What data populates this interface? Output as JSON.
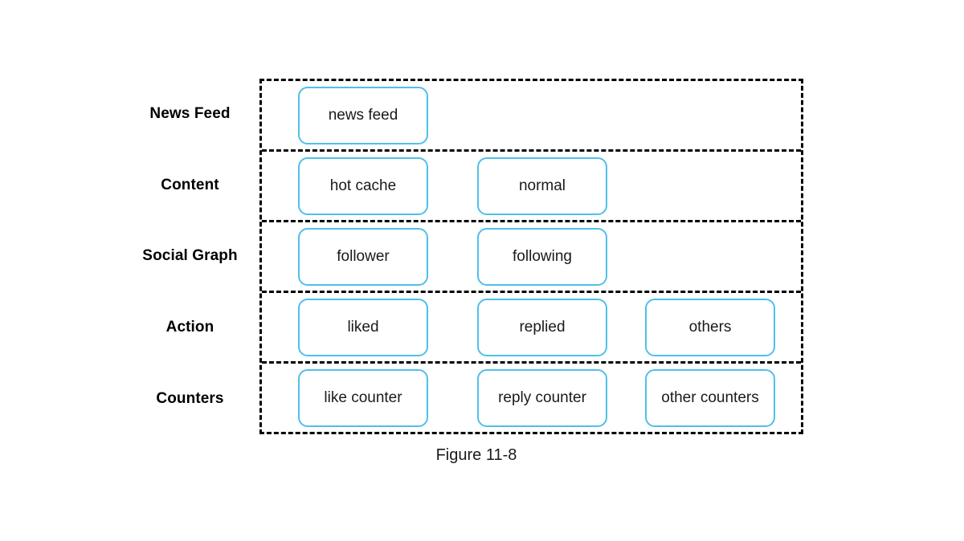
{
  "figure": {
    "caption": "Figure 11-8",
    "accent_color": "#4FC0E8",
    "boundary_color": "#000000",
    "background_color": "#ffffff"
  },
  "tiers": [
    {
      "label": "News Feed",
      "nodes": [
        {
          "label": "news feed"
        }
      ]
    },
    {
      "label": "Content",
      "nodes": [
        {
          "label": "hot cache"
        },
        {
          "label": "normal"
        }
      ]
    },
    {
      "label": "Social Graph",
      "nodes": [
        {
          "label": "follower"
        },
        {
          "label": "following"
        }
      ]
    },
    {
      "label": "Action",
      "nodes": [
        {
          "label": "liked"
        },
        {
          "label": "replied"
        },
        {
          "label": "others"
        }
      ]
    },
    {
      "label": "Counters",
      "nodes": [
        {
          "label": "like counter"
        },
        {
          "label": "reply counter"
        },
        {
          "label": "other counters"
        }
      ]
    }
  ]
}
